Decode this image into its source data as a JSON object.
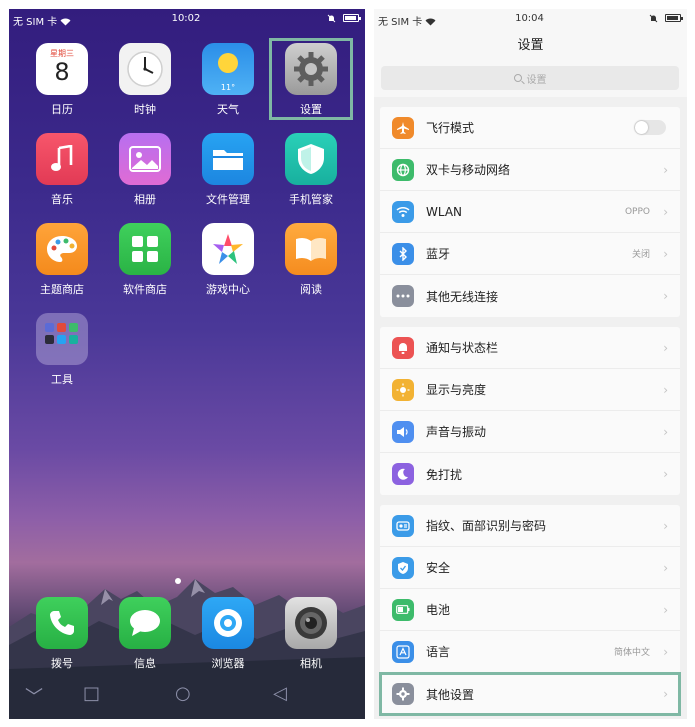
{
  "home": {
    "status": {
      "carrier": "无 SIM 卡",
      "time": "10:02"
    },
    "apps": [
      {
        "label": "日历",
        "icon": "calendar-icon",
        "weekday": "星期三",
        "day": "8"
      },
      {
        "label": "时钟",
        "icon": "clock-icon"
      },
      {
        "label": "天气",
        "icon": "weather-icon",
        "temp": "11°"
      },
      {
        "label": "设置",
        "icon": "settings-gear-icon"
      },
      {
        "label": "音乐",
        "icon": "music-icon"
      },
      {
        "label": "相册",
        "icon": "gallery-icon"
      },
      {
        "label": "文件管理",
        "icon": "folder-icon"
      },
      {
        "label": "手机管家",
        "icon": "shield-icon"
      },
      {
        "label": "主题商店",
        "icon": "palette-icon"
      },
      {
        "label": "软件商店",
        "icon": "app-store-icon"
      },
      {
        "label": "游戏中心",
        "icon": "game-center-icon"
      },
      {
        "label": "阅读",
        "icon": "book-icon"
      },
      {
        "label": "工具",
        "icon": "folder-tools-icon"
      }
    ],
    "dock": [
      {
        "label": "拨号",
        "icon": "phone-icon"
      },
      {
        "label": "信息",
        "icon": "message-icon"
      },
      {
        "label": "浏览器",
        "icon": "browser-icon"
      },
      {
        "label": "相机",
        "icon": "camera-icon"
      }
    ],
    "nav": {
      "back": "﹀",
      "home": "□",
      "recent": "○",
      "return": "◁"
    }
  },
  "settings": {
    "status": {
      "carrier": "无 SIM 卡",
      "time": "10:04"
    },
    "title": "设置",
    "search_placeholder": "设置",
    "groups": [
      [
        {
          "label": "飞行模式",
          "icon": "airplane-icon",
          "color": "#f08a2b",
          "toggle": true
        },
        {
          "label": "双卡与移动网络",
          "icon": "globe-icon",
          "color": "#3dbb6b"
        },
        {
          "label": "WLAN",
          "icon": "wifi-icon",
          "color": "#3b9be8",
          "value": "OPPO"
        },
        {
          "label": "蓝牙",
          "icon": "bluetooth-icon",
          "color": "#3b8fe8",
          "value": "关闭"
        },
        {
          "label": "其他无线连接",
          "icon": "more-dots-icon",
          "color": "#8a8f9c"
        }
      ],
      [
        {
          "label": "通知与状态栏",
          "icon": "notification-icon",
          "color": "#ec5353"
        },
        {
          "label": "显示与亮度",
          "icon": "brightness-icon",
          "color": "#f2b233"
        },
        {
          "label": "声音与振动",
          "icon": "speaker-icon",
          "color": "#4f8ff0"
        },
        {
          "label": "免打扰",
          "icon": "moon-icon",
          "color": "#8c62e0"
        }
      ],
      [
        {
          "label": "指纹、面部识别与密码",
          "icon": "fingerprint-icon",
          "color": "#3b9be8"
        },
        {
          "label": "安全",
          "icon": "security-shield-icon",
          "color": "#3b9be8"
        },
        {
          "label": "电池",
          "icon": "battery-icon",
          "color": "#3dbb6b"
        },
        {
          "label": "语言",
          "icon": "language-icon",
          "color": "#3b8fe8",
          "value": "简体中文"
        },
        {
          "label": "其他设置",
          "icon": "gear-icon",
          "color": "#8a8f9c"
        }
      ]
    ]
  }
}
